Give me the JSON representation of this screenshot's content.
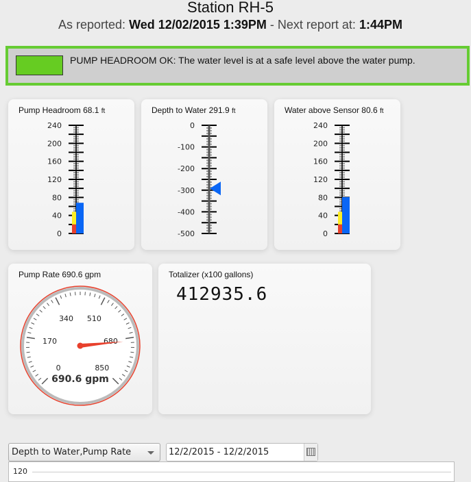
{
  "header": {
    "title": "Station RH-5",
    "reported_label": "As reported:",
    "reported_time": "Wed 12/02/2015 1:39PM",
    "next_label": "- Next report at:",
    "next_time": "1:44PM"
  },
  "alert": {
    "text": "PUMP HEADROOM OK: The water level is at a safe level above the water pump.",
    "status_color": "#66cc22"
  },
  "gauges": [
    {
      "title": "Pump Headroom",
      "value": "68.1",
      "unit": "ft",
      "numeric": 68.1,
      "min": 0,
      "max": 240,
      "labels": [
        "240",
        "200",
        "160",
        "120",
        "80",
        "40",
        "0"
      ],
      "red_to": 20,
      "yellow_to": 48
    },
    {
      "title": "Depth to Water",
      "value": "291.9",
      "unit": "ft",
      "numeric": -291.9,
      "min": -500,
      "max": 0,
      "labels": [
        "0",
        "-100",
        "-200",
        "-300",
        "-400",
        "-500"
      ]
    },
    {
      "title": "Water above Sensor",
      "value": "80.6",
      "unit": "ft",
      "numeric": 80.6,
      "min": 0,
      "max": 240,
      "labels": [
        "240",
        "200",
        "160",
        "120",
        "80",
        "40",
        "0"
      ],
      "red_to": 20,
      "yellow_to": 48
    }
  ],
  "pump_rate": {
    "title": "Pump Rate 690.6 gpm",
    "value": 690.6,
    "readout": "690.6 gpm",
    "min": 0,
    "max": 850,
    "labels": [
      "0",
      "170",
      "340",
      "510",
      "680",
      "850"
    ]
  },
  "totalizer": {
    "title": "Totalizer (x100 gallons)",
    "value": "412935.6"
  },
  "controls": {
    "series_select": "Depth to Water,Pump Rate",
    "date_range": "12/2/2015 - 12/2/2015"
  },
  "chart": {
    "y_top_label": "120"
  }
}
